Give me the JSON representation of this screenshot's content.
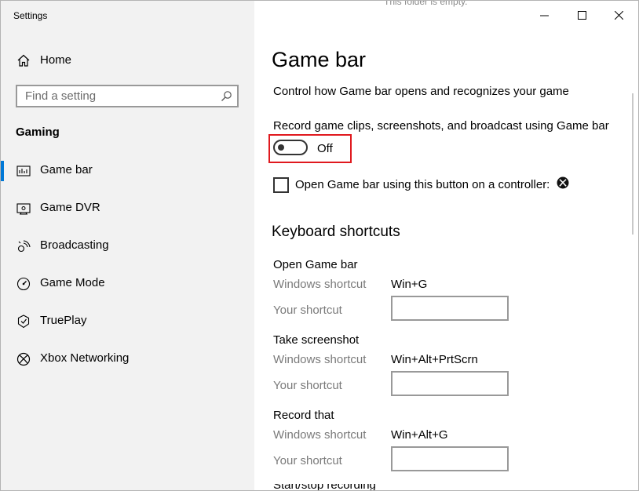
{
  "window": {
    "title": "Settings"
  },
  "background_fragment": "This folder is empty.",
  "sidebar": {
    "home_label": "Home",
    "search_placeholder": "Find a setting",
    "section_title": "Gaming",
    "items": [
      {
        "label": "Game bar",
        "icon": "game-bar-icon",
        "active": true
      },
      {
        "label": "Game DVR",
        "icon": "game-dvr-icon",
        "active": false
      },
      {
        "label": "Broadcasting",
        "icon": "broadcasting-icon",
        "active": false
      },
      {
        "label": "Game Mode",
        "icon": "game-mode-icon",
        "active": false
      },
      {
        "label": "TruePlay",
        "icon": "trueplay-icon",
        "active": false
      },
      {
        "label": "Xbox Networking",
        "icon": "xbox-icon",
        "active": false
      }
    ]
  },
  "main": {
    "title": "Game bar",
    "description": "Control how Game bar opens and recognizes your game",
    "record_toggle": {
      "label": "Record game clips, screenshots, and broadcast using Game bar",
      "state": "Off",
      "on": false
    },
    "controller_checkbox": {
      "label": "Open Game bar using this button on a controller:",
      "checked": false
    },
    "keyboard_title": "Keyboard shortcuts",
    "shortcuts": [
      {
        "title": "Open Game bar",
        "windows_label": "Windows shortcut",
        "windows_value": "Win+G",
        "your_label": "Your shortcut",
        "your_value": ""
      },
      {
        "title": "Take screenshot",
        "windows_label": "Windows shortcut",
        "windows_value": "Win+Alt+PrtScrn",
        "your_label": "Your shortcut",
        "your_value": ""
      },
      {
        "title": "Record that",
        "windows_label": "Windows shortcut",
        "windows_value": "Win+Alt+G",
        "your_label": "Your shortcut",
        "your_value": ""
      }
    ],
    "cut_off_text": "Start/stop recording"
  },
  "colors": {
    "accent": "#0078d7",
    "highlight_box": "#e0191e",
    "sidebar_bg": "#f2f2f2",
    "muted_text": "#7a7a7a"
  }
}
